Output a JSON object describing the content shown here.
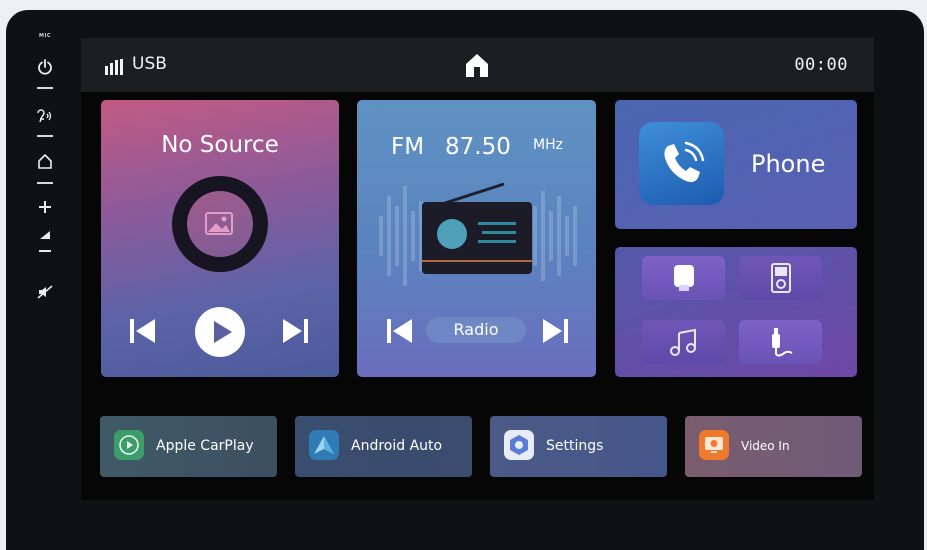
{
  "sidebar": {
    "mic_label": "MIC",
    "icons": [
      "power-icon",
      "voice-assistant-icon",
      "home-outline-icon",
      "volume-up-icon",
      "volume-down-icon",
      "mute-icon"
    ]
  },
  "statusbar": {
    "source": "USB",
    "time": "00:00"
  },
  "music": {
    "title": "No Source"
  },
  "radio": {
    "band": "FM",
    "frequency": "87.50",
    "unit": "MHz",
    "label": "Radio"
  },
  "phone": {
    "label": "Phone"
  },
  "media_grid": [
    "usb-drive-icon",
    "ipod-icon",
    "music-note-icon",
    "aux-cable-icon"
  ],
  "apps": [
    {
      "label": "Apple CarPlay",
      "color": "#3a9d6a"
    },
    {
      "label": "Android Auto",
      "color": "#2e7bb6"
    },
    {
      "label": "Settings",
      "color": "#5b7cd6"
    },
    {
      "label": "Video In",
      "color": "#f07a2c"
    }
  ],
  "colors": {
    "accent_blue": "#5a84c0",
    "accent_purple": "#6a53b6",
    "background": "#060607"
  }
}
